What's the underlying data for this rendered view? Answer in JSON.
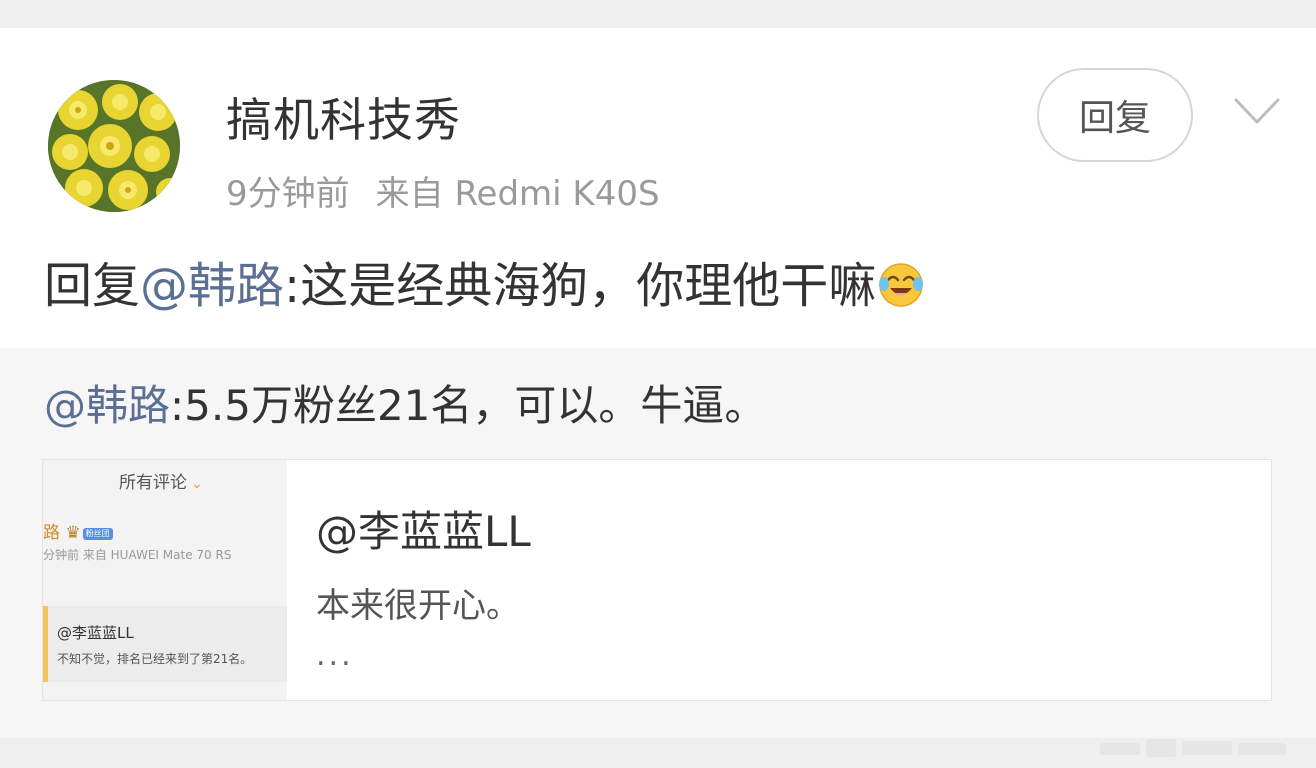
{
  "post": {
    "author_name": "搞机科技秀",
    "time_ago": "9分钟前",
    "source": "来自 Redmi K40S",
    "reply_label": "回复",
    "more_icon": "chevron-down-icon",
    "content": {
      "prefix": "回复",
      "mention": "@韩路",
      "text": ":这是经典海狗，你理他干嘛",
      "emoji": "laughing-crying-emoji"
    }
  },
  "quoted": {
    "mention": "@韩路",
    "text": ":5.5万粉丝21名，可以。牛逼。",
    "link_card": {
      "title": "@李蓝蓝LL",
      "description": "本来很开心。",
      "ellipsis": "...",
      "thumbnail": {
        "filter_label": "所有评论",
        "user": "路",
        "badge": "粉丝团",
        "meta": "分钟前  来自 HUAWEI Mate 70 RS",
        "sub_name": "@李蓝蓝LL",
        "sub_text": "不知不觉，排名已经来到了第21名。"
      }
    }
  },
  "colors": {
    "mention": "#5b6f94",
    "background": "#efefef",
    "card": "#ffffff",
    "quote_bg": "#f6f6f6"
  }
}
